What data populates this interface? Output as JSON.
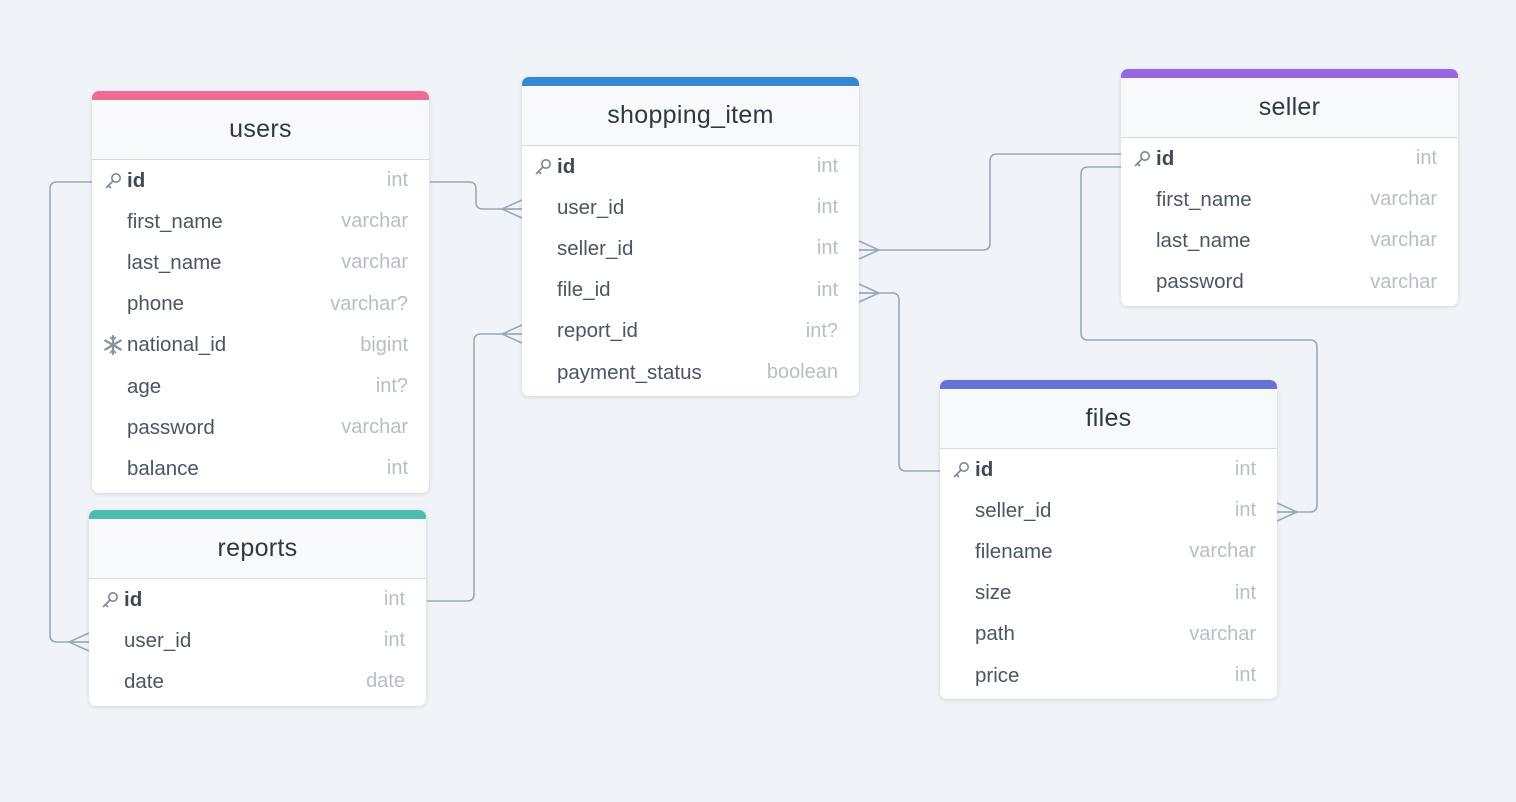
{
  "colors": {
    "background": "#f0f4f8",
    "connector": "#9aa8ba",
    "users": "#ec6c95",
    "shopping_item": "#3686d3",
    "seller": "#9866e0",
    "reports": "#4dbcae",
    "files": "#6672d6"
  },
  "tables": {
    "users": {
      "name": "users",
      "columns": [
        {
          "name": "id",
          "type": "int",
          "icon": "key-icon"
        },
        {
          "name": "first_name",
          "type": "varchar"
        },
        {
          "name": "last_name",
          "type": "varchar"
        },
        {
          "name": "phone",
          "type": "varchar?"
        },
        {
          "name": "national_id",
          "type": "bigint",
          "icon": "snowflake-icon"
        },
        {
          "name": "age",
          "type": "int?"
        },
        {
          "name": "password",
          "type": "varchar"
        },
        {
          "name": "balance",
          "type": "int"
        }
      ]
    },
    "shopping_item": {
      "name": "shopping_item",
      "columns": [
        {
          "name": "id",
          "type": "int",
          "icon": "key-icon"
        },
        {
          "name": "user_id",
          "type": "int"
        },
        {
          "name": "seller_id",
          "type": "int"
        },
        {
          "name": "file_id",
          "type": "int"
        },
        {
          "name": "report_id",
          "type": "int?"
        },
        {
          "name": "payment_status",
          "type": "boolean"
        }
      ]
    },
    "seller": {
      "name": "seller",
      "columns": [
        {
          "name": "id",
          "type": "int",
          "icon": "key-icon"
        },
        {
          "name": "first_name",
          "type": "varchar"
        },
        {
          "name": "last_name",
          "type": "varchar"
        },
        {
          "name": "password",
          "type": "varchar"
        }
      ]
    },
    "reports": {
      "name": "reports",
      "columns": [
        {
          "name": "id",
          "type": "int",
          "icon": "key-icon"
        },
        {
          "name": "user_id",
          "type": "int"
        },
        {
          "name": "date",
          "type": "date"
        }
      ]
    },
    "files": {
      "name": "files",
      "columns": [
        {
          "name": "id",
          "type": "int",
          "icon": "key-icon"
        },
        {
          "name": "seller_id",
          "type": "int"
        },
        {
          "name": "filename",
          "type": "varchar"
        },
        {
          "name": "size",
          "type": "int"
        },
        {
          "name": "path",
          "type": "varchar"
        },
        {
          "name": "price",
          "type": "int"
        }
      ]
    }
  },
  "relationships": [
    {
      "from": "users.id",
      "to": "shopping_item.user_id",
      "cardinality": "one-to-many"
    },
    {
      "from": "users.id",
      "to": "reports.user_id",
      "cardinality": "one-to-many"
    },
    {
      "from": "reports.id",
      "to": "shopping_item.report_id",
      "cardinality": "one-to-many"
    },
    {
      "from": "seller.id",
      "to": "shopping_item.seller_id",
      "cardinality": "one-to-many"
    },
    {
      "from": "seller.id",
      "to": "files.seller_id",
      "cardinality": "one-to-many"
    },
    {
      "from": "files.id",
      "to": "shopping_item.file_id",
      "cardinality": "one-to-many"
    }
  ]
}
